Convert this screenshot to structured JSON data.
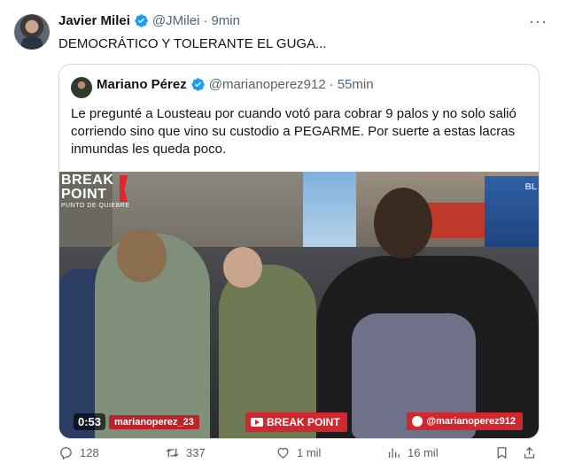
{
  "tweet": {
    "author_name": "Javier Milei",
    "author_handle": "@JMilei",
    "separator": "·",
    "time": "9min",
    "more": "···",
    "text": "DEMOCRÁTICO Y TOLERANTE EL GUGA..."
  },
  "quote": {
    "author_name": "Mariano Pérez",
    "author_handle": "@marianoperez912",
    "separator": "·",
    "time": "55min",
    "text": "Le pregunté a Lousteau por cuando votó para cobrar 9 palos y no solo salió corriendo sino que vino su custodio a PEGARME. Por suerte a estas lacras inmundas les queda poco.",
    "video": {
      "logo_line1": "BREAK",
      "logo_line2": "POINT",
      "logo_sub": "PUNTO DE QUIEBRE",
      "watermark": "BL",
      "duration": "0:53",
      "credit_left": "marianoperez_23",
      "credit_center": "BREAK POINT",
      "credit_right": "@marianoperez912"
    }
  },
  "actions": {
    "replies": "128",
    "retweets": "337",
    "likes": "1 mil",
    "views": "16 mil"
  },
  "colors": {
    "verified": "#1d9bf0",
    "secondary_text": "#536471",
    "border": "#cfd9de",
    "accent_red": "#d0282e"
  }
}
